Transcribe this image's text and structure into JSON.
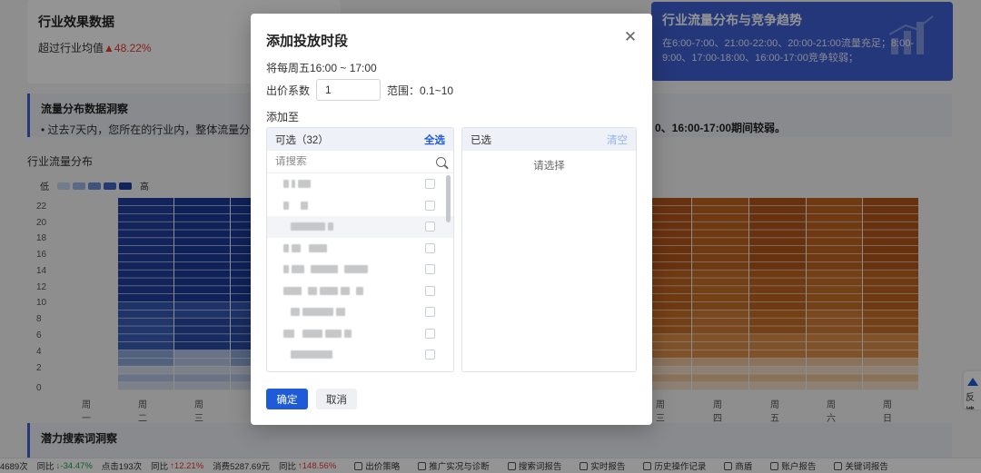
{
  "background": {
    "industry_card": {
      "title": "行业效果数据",
      "subtitle_prefix": "超过行业均值",
      "subtitle_value": "▲48.22%"
    },
    "trend_card": {
      "title": "行业流量分布与竞争趋势",
      "description": "在6:00-7:00、21:00-22:00、20:00-21:00流量充足；8:00-9:00、17:00-18:00、16:00-17:00竞争较弱；"
    },
    "insight": {
      "title": "流量分布数据洞察",
      "text_left": "• 过去7天内，您所在的行业内，整体流量分布在6",
      "text_right": "0、16:00-17:00期间较弱。"
    },
    "flow_title": "行业流量分布",
    "legend": {
      "low": "低",
      "high": "高",
      "colors": [
        "#c7d6f2",
        "#9cb6e6",
        "#6b8fd6",
        "#3d66c4",
        "#1a3f9e"
      ]
    },
    "y_ticks": [
      "22",
      "20",
      "18",
      "16",
      "14",
      "12",
      "10",
      "8",
      "6",
      "4",
      "2",
      "0"
    ],
    "x_left": [
      "周一",
      "周二",
      "周三"
    ],
    "x_right": [
      "周三",
      "周四",
      "周五",
      "周六",
      "周日"
    ],
    "potential_title": "潜力搜索词洞察",
    "feedback": "反馈",
    "statusbar": {
      "items": [
        {
          "text": "4689次",
          "icon": ""
        },
        {
          "text": "同比",
          "icon": ""
        },
        {
          "text": "↓-34.47%",
          "icon": "",
          "cls": "down"
        },
        {
          "text": "点击193次",
          "icon": ""
        },
        {
          "text": "同比",
          "icon": ""
        },
        {
          "text": "↑12.21%",
          "icon": "",
          "cls": "upc"
        },
        {
          "text": "消费5287.69元",
          "icon": ""
        },
        {
          "text": "同比",
          "icon": ""
        },
        {
          "text": "↑148.56%",
          "icon": "",
          "cls": "upc"
        }
      ],
      "links": [
        "出价策略",
        "推广实况与诊断",
        "搜索词报告",
        "实时报告",
        "历史操作记录",
        "商盾",
        "账户报告",
        "关键词报告"
      ]
    }
  },
  "modal": {
    "title": "添加投放时段",
    "time_line": "将每周五16:00 ~ 17:00",
    "bid_label": "出价系数",
    "bid_value": "1",
    "range_label": "范围：0.1~10",
    "add_to_label": "添加至",
    "available": {
      "header": "可选（32）",
      "select_all": "全选",
      "search_placeholder": "请搜索"
    },
    "selected": {
      "header": "已选",
      "clear": "清空",
      "empty_text": "请选择"
    },
    "confirm": "确定",
    "cancel": "取消"
  }
}
